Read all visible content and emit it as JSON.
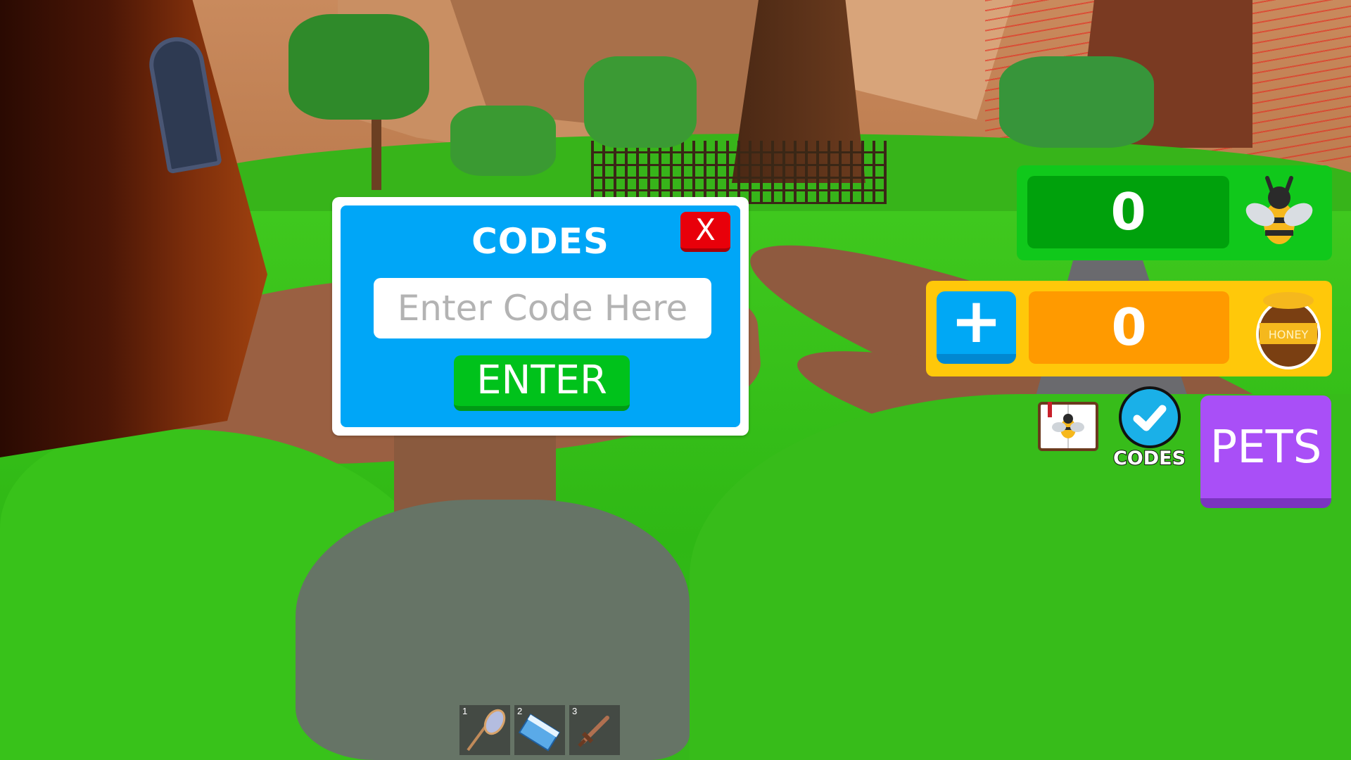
{
  "codes_dialog": {
    "title": "CODES",
    "close_label": "X",
    "input_value": "",
    "input_placeholder": "Enter Code Here",
    "enter_label": "ENTER"
  },
  "hud": {
    "bee_count": "0",
    "honey_count": "0",
    "plus_label": "+",
    "bee_icon": "bee-icon",
    "honey_icon": "honey-pot-icon",
    "honey_pot_text": "HONEY",
    "book_icon": "bee-book-icon",
    "codes_button_label": "CODES",
    "pets_label": "PETS"
  },
  "hotbar": [
    {
      "slot": "1",
      "item": "net-icon"
    },
    {
      "slot": "2",
      "item": "blue-block-icon"
    },
    {
      "slot": "3",
      "item": "sword-icon"
    }
  ],
  "colors": {
    "dialog_blue": "#00a6f7",
    "close_red": "#e8000a",
    "enter_green": "#00c21b",
    "bee_panel_green": "#10c81b",
    "honey_panel_yellow": "#ffc80a",
    "honey_count_orange": "#ff9a00",
    "pets_purple": "#a94ff7"
  }
}
